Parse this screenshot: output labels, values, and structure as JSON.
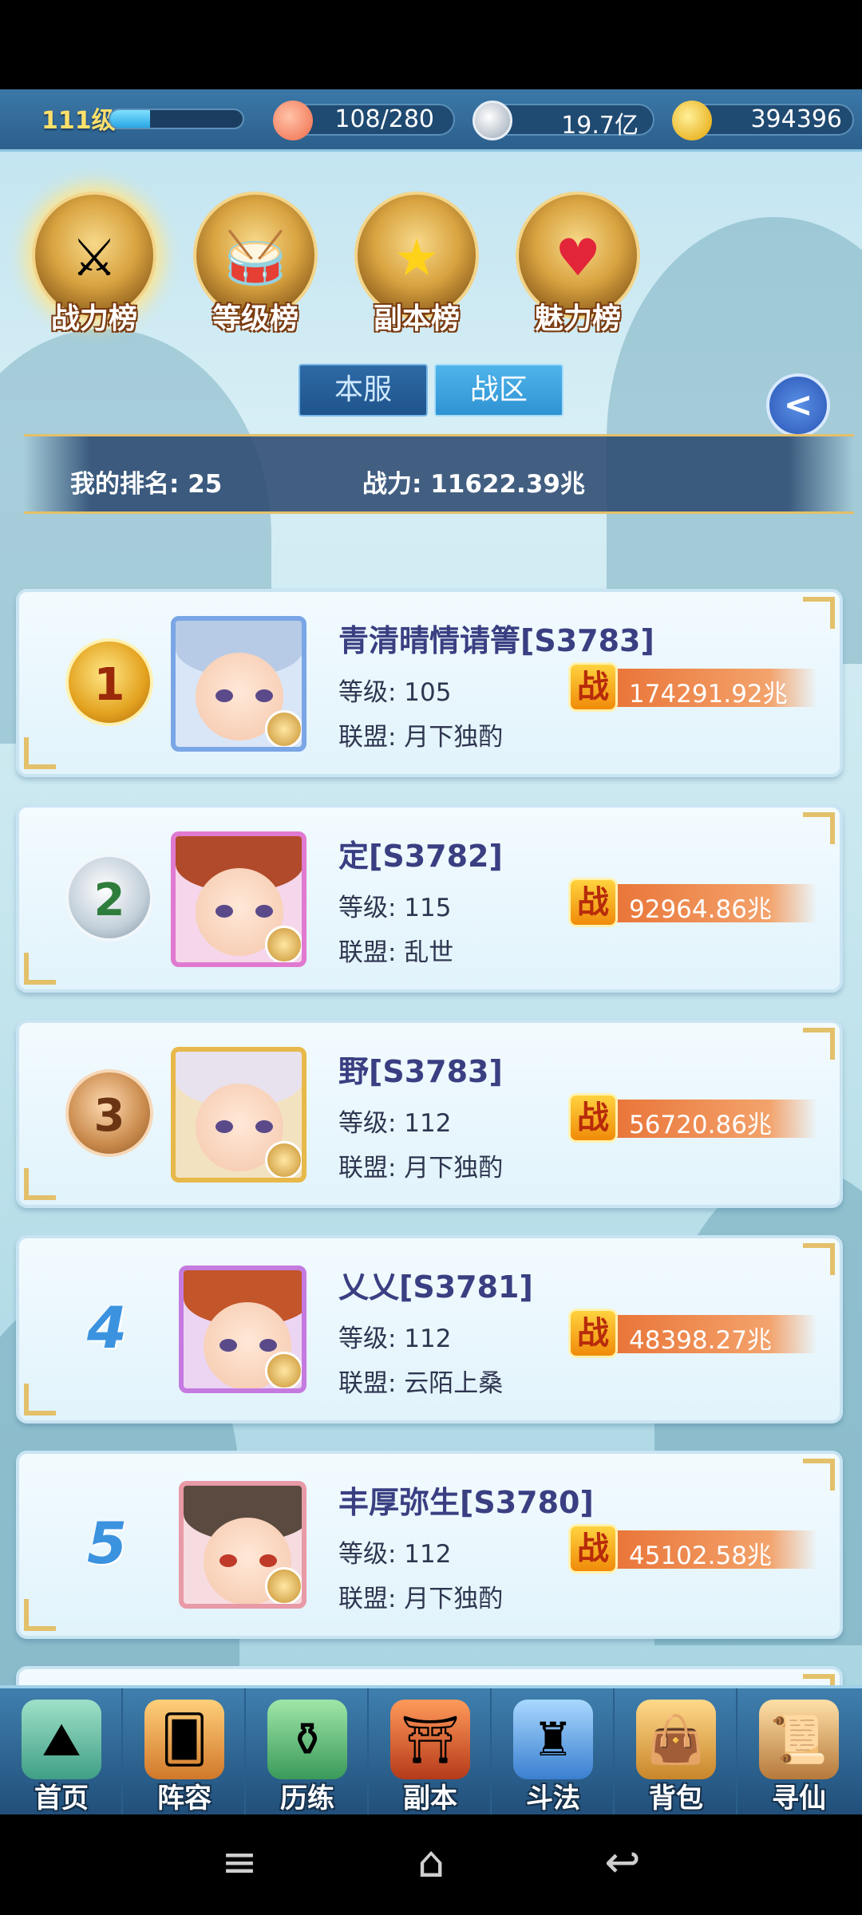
{
  "top_bar": {
    "level": "111级",
    "exp_fraction": 0.3,
    "stamina": "108/280",
    "silver": "19.7亿",
    "gold": "394396"
  },
  "rank_tabs": [
    {
      "label": "战力榜",
      "active": true
    },
    {
      "label": "等级榜",
      "active": false
    },
    {
      "label": "副本榜",
      "active": false
    },
    {
      "label": "魅力榜",
      "active": false
    }
  ],
  "server_tabs": {
    "local": "本服",
    "zone": "战区",
    "active": "local"
  },
  "my_rank": {
    "rank_text": "我的排名: 25",
    "power_text": "战力: 11622.39兆"
  },
  "power_icon_char": "战",
  "entries": [
    {
      "rank": "1",
      "name": "青清晴情请箐[S3783]",
      "level": "等级: 105",
      "guild": "联盟: 月下独酌",
      "power": "174291.92兆"
    },
    {
      "rank": "2",
      "name": "定[S3782]",
      "level": "等级: 115",
      "guild": "联盟: 乱世",
      "power": "92964.86兆"
    },
    {
      "rank": "3",
      "name": "野[S3783]",
      "level": "等级: 112",
      "guild": "联盟: 月下独酌",
      "power": "56720.86兆"
    },
    {
      "rank": "4",
      "name": "乂乂[S3781]",
      "level": "等级: 112",
      "guild": "联盟: 云陌上桑",
      "power": "48398.27兆"
    },
    {
      "rank": "5",
      "name": "丰厚弥生[S3780]",
      "level": "等级: 112",
      "guild": "联盟: 月下独酌",
      "power": "45102.58兆"
    }
  ],
  "bottom_nav": [
    {
      "label": "首页",
      "icon": "home-icon"
    },
    {
      "label": "阵容",
      "icon": "cards-icon"
    },
    {
      "label": "历练",
      "icon": "gourd-icon"
    },
    {
      "label": "副本",
      "icon": "gate-icon"
    },
    {
      "label": "斗法",
      "icon": "tower-icon"
    },
    {
      "label": "背包",
      "icon": "bag-icon"
    },
    {
      "label": "寻仙",
      "icon": "scroll-icon"
    }
  ],
  "colors": {
    "accent_gold": "#e3c06a",
    "name_color": "#3a3f82",
    "power_orange": "#e76a2c"
  }
}
